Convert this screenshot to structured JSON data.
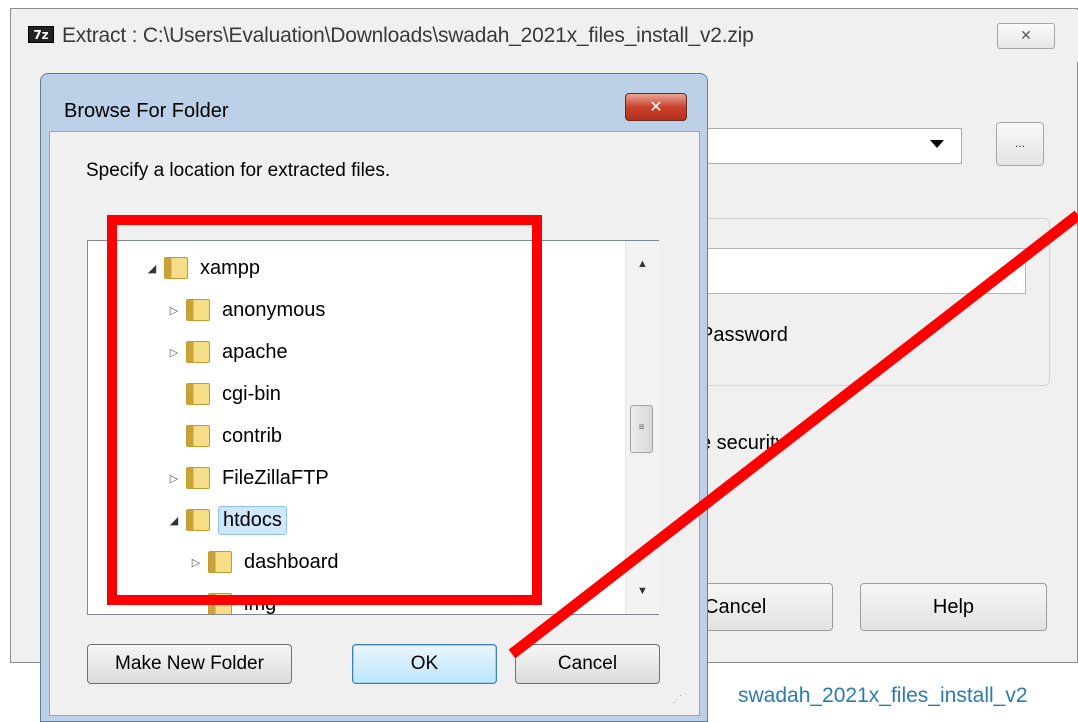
{
  "extract_window": {
    "icon_text": "7z",
    "title": "Extract : C:\\Users\\Evaluation\\Downloads\\swadah_2021x_files_install_v2.zip",
    "close_glyph": "✕",
    "browse_label": "...",
    "show_password_label": "Password",
    "security_label": "e security",
    "cancel_label": "Cancel",
    "help_label": "Help"
  },
  "taskbar_filename": "swadah_2021x_files_install_v2",
  "browse_dialog": {
    "title": "Browse For Folder",
    "close_glyph": "✕",
    "instruction": "Specify a location for extracted files.",
    "tree": [
      {
        "label": "xampp",
        "depth": 0,
        "expander": "open"
      },
      {
        "label": "anonymous",
        "depth": 1,
        "expander": "closed"
      },
      {
        "label": "apache",
        "depth": 1,
        "expander": "closed"
      },
      {
        "label": "cgi-bin",
        "depth": 1,
        "expander": "none"
      },
      {
        "label": "contrib",
        "depth": 1,
        "expander": "none"
      },
      {
        "label": "FileZillaFTP",
        "depth": 1,
        "expander": "closed"
      },
      {
        "label": "htdocs",
        "depth": 1,
        "expander": "open",
        "selected": true
      },
      {
        "label": "dashboard",
        "depth": 2,
        "expander": "closed"
      },
      {
        "label": "img",
        "depth": 2,
        "expander": "none"
      }
    ],
    "buttons": {
      "new_folder": "Make New Folder",
      "ok": "OK",
      "cancel": "Cancel"
    }
  },
  "colors": {
    "annotation": "#ff0000",
    "selection": "#cfe6fb",
    "link_text": "#2b7bb2"
  }
}
